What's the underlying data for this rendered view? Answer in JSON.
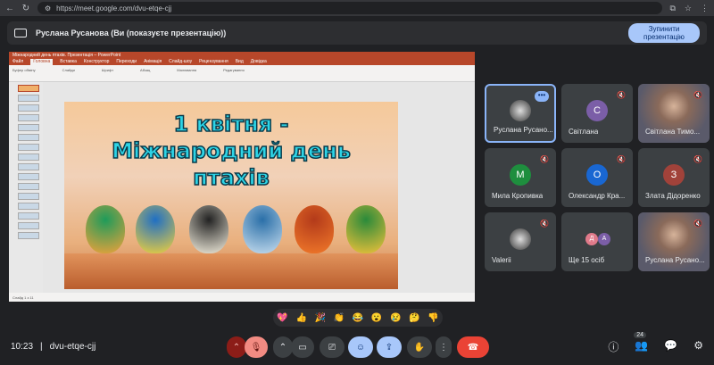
{
  "browser": {
    "url": "https://meet.google.com/dvu-etqe-cjj"
  },
  "banner": {
    "title": "Руслана Русанова (Ви (показуєте презентацію))",
    "stop_label": "Зупинити презентацію"
  },
  "ppt": {
    "window_title": "Міжнародний день птахів. Презентація – PowerPoint",
    "tabs": [
      "Файл",
      "Головна",
      "Вставка",
      "Конструктор",
      "Переходи",
      "Анімація",
      "Слайд-шоу",
      "Рецензування",
      "Вид",
      "Довідка"
    ],
    "active_tab": "Головна",
    "groups": [
      "Буфер обміну",
      "Слайди",
      "Шрифт",
      "Абзац",
      "Малювання",
      "Редагування"
    ],
    "status_left": "Слайд 1 з 11",
    "slide_title_line1": "1 квітня -",
    "slide_title_line2": "Міжнародний день",
    "slide_title_line3": "птахів"
  },
  "participants": [
    {
      "name": "Руслана Русано...",
      "type": "photo",
      "me": true
    },
    {
      "name": "Світлана",
      "initial": "С",
      "color": "#7b5ea7"
    },
    {
      "name": "Світлана Тимо...",
      "type": "photo2"
    },
    {
      "name": "Мила Кропивка",
      "initial": "М",
      "color": "#1e8e3e"
    },
    {
      "name": "Олександр Кра...",
      "initial": "О",
      "color": "#1967d2"
    },
    {
      "name": "Злата Дідоренко",
      "initial": "З",
      "color": "#a1423a"
    },
    {
      "name": "Valerii",
      "type": "photo3"
    },
    {
      "name": "Ще 15 осіб",
      "type": "more"
    },
    {
      "name": "Руслана Русано...",
      "type": "photo4"
    }
  ],
  "more_avatars": [
    "Д",
    "А"
  ],
  "reactions": [
    "💖",
    "👍",
    "🎉",
    "👏",
    "😂",
    "😮",
    "😢",
    "🤔",
    "👎"
  ],
  "meeting": {
    "time": "10:23",
    "code": "dvu-etqe-cjj",
    "participant_count": "24"
  }
}
